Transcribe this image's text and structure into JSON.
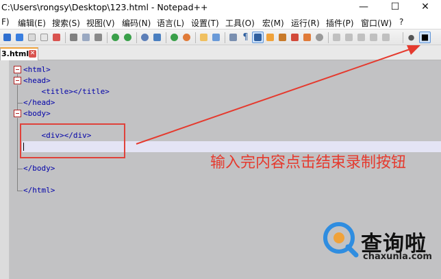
{
  "window": {
    "title": "C:\\Users\\rongsy\\Desktop\\123.html - Notepad++",
    "minimize_glyph": "—",
    "maximize_glyph": "☐",
    "close_glyph": "✕"
  },
  "menu": [
    "F)",
    "编辑(E)",
    "搜索(S)",
    "视图(V)",
    "编码(N)",
    "语言(L)",
    "设置(T)",
    "工具(O)",
    "宏(M)",
    "运行(R)",
    "插件(P)",
    "窗口(W)",
    "?"
  ],
  "toolbar": {
    "icons": [
      "save-icon",
      "save-all-icon",
      "close-icon",
      "close-all-icon",
      "print-icon",
      "cut-icon",
      "copy-icon",
      "paste-icon",
      "undo-icon",
      "redo-icon",
      "find-icon",
      "replace-icon",
      "zoom-in-icon",
      "zoom-out-icon",
      "sync-v-icon",
      "sync-h-icon",
      "word-wrap-icon",
      "show-all-chars-icon",
      "indent-guide-icon",
      "doc-map-icon",
      "func-list-icon",
      "folder-workspace-icon",
      "monitor-icon",
      "record-macro-icon",
      "stop-record-icon"
    ],
    "colors": {
      "green": "#3aa04a",
      "blue": "#2f6fd0",
      "orange": "#f0a23a",
      "red": "#d9534f",
      "gray": "#808080"
    },
    "pilcrow": "¶",
    "stop_glyph": "■",
    "record_glyph": "●"
  },
  "tab": {
    "label": "3.html",
    "close_glyph": "✕"
  },
  "editor": {
    "lines": [
      "<html>",
      "<head>",
      "    <title></title>",
      "</head>",
      "<body>",
      "",
      "    <div></div>",
      "",
      "",
      "</body>",
      "",
      "</html>"
    ]
  },
  "annotation": {
    "text": "输入完内容点击结束录制按钮",
    "color": "#e53a2e"
  },
  "watermark": {
    "brand": "查询啦",
    "domain": "chaxunla.com"
  }
}
